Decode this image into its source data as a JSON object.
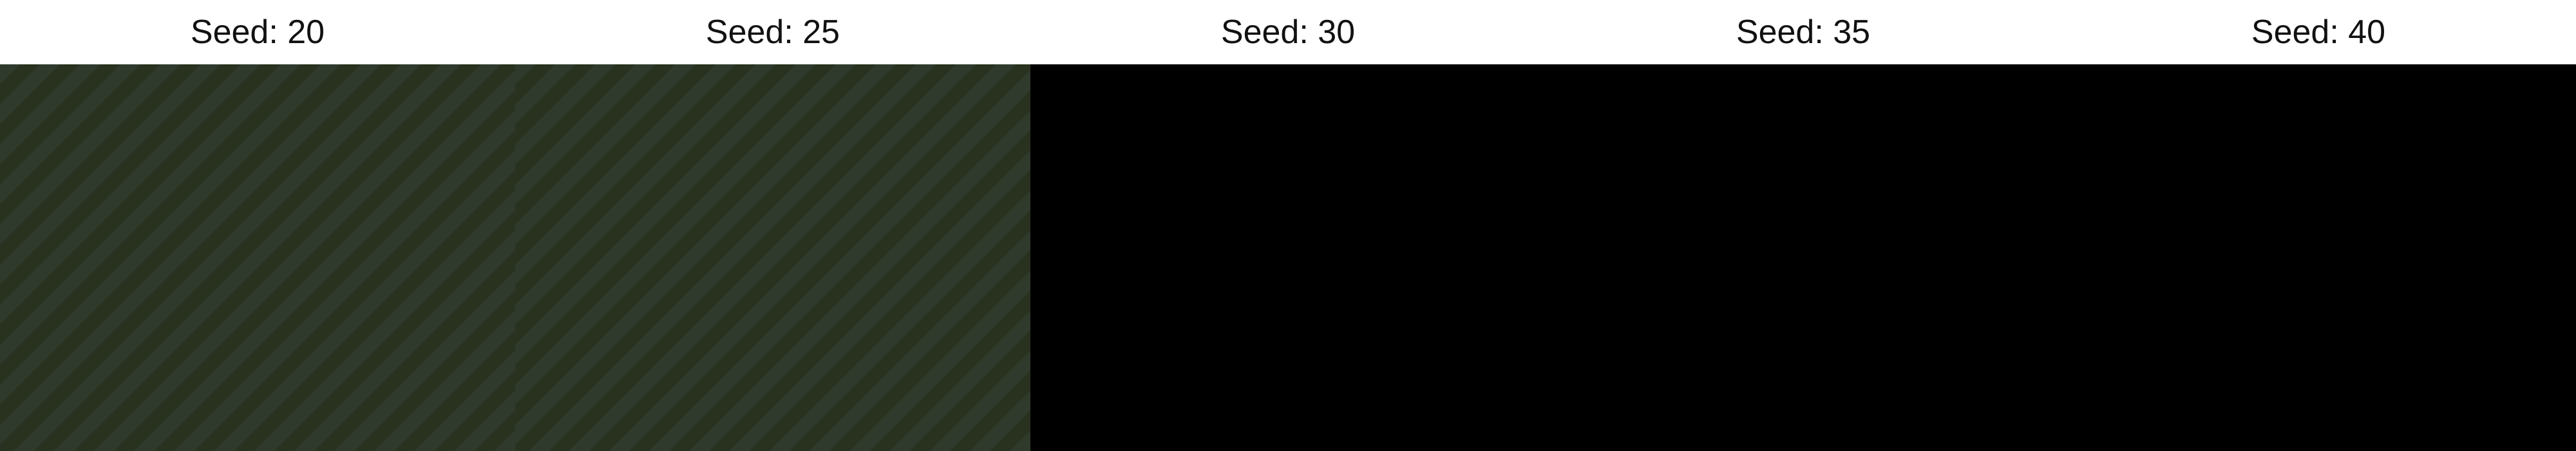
{
  "panels": [
    {
      "label": "Seed: 20",
      "image_state": "placeholder"
    },
    {
      "label": "Seed: 25",
      "image_state": "placeholder"
    },
    {
      "label": "Seed: 30",
      "image_state": "black"
    },
    {
      "label": "Seed: 35",
      "image_state": "black"
    },
    {
      "label": "Seed: 40",
      "image_state": "black"
    }
  ],
  "placeholder_text": "",
  "colors": {
    "label_bg": "#ffffff",
    "label_text": "#111111",
    "empty_image": "#000000"
  }
}
